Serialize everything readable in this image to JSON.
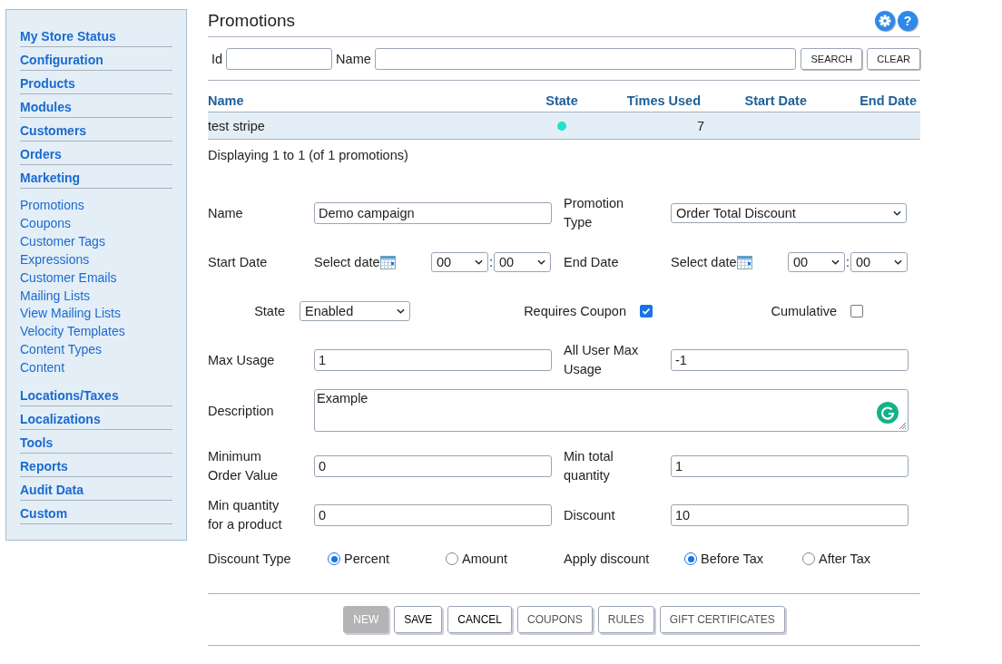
{
  "sidebar": {
    "items": [
      {
        "label": "My Store Status"
      },
      {
        "label": "Configuration"
      },
      {
        "label": "Products"
      },
      {
        "label": "Modules"
      },
      {
        "label": "Customers"
      },
      {
        "label": "Orders"
      },
      {
        "label": "Marketing",
        "children": [
          {
            "label": "Promotions"
          },
          {
            "label": "Coupons"
          },
          {
            "label": "Customer Tags"
          },
          {
            "label": "Expressions"
          },
          {
            "label": "Customer Emails"
          },
          {
            "label": "Mailing Lists"
          },
          {
            "label": "View Mailing Lists"
          },
          {
            "label": "Velocity Templates"
          },
          {
            "label": "Content Types"
          },
          {
            "label": "Content"
          }
        ]
      },
      {
        "label": "Locations/Taxes"
      },
      {
        "label": "Localizations"
      },
      {
        "label": "Tools"
      },
      {
        "label": "Reports"
      },
      {
        "label": "Audit Data"
      },
      {
        "label": "Custom"
      }
    ]
  },
  "page": {
    "title": "Promotions",
    "help_label": "?"
  },
  "search": {
    "id_label": "Id",
    "name_label": "Name",
    "buttons": [
      "SEARCH",
      "CLEAR"
    ]
  },
  "table": {
    "columns": [
      "Name",
      "State",
      "Times Used",
      "Start Date",
      "End Date"
    ],
    "rows": [
      {
        "name": "test stripe",
        "color": "#1de3cf",
        "times_used": "7"
      }
    ]
  },
  "summary": "Displaying 1 to 1 (of 1 promotions)",
  "form": {
    "rows": [
      {
        "kind": "pair",
        "items": [
          {
            "kind": "text",
            "label": "Name",
            "value": "Demo campaign"
          },
          {
            "kind": "select",
            "label": "Promotion Type",
            "value": "Order Total Discount"
          }
        ]
      },
      {
        "kind": "pair",
        "items": [
          {
            "kind": "date",
            "label": "Start Date",
            "placeholder": "Select date",
            "hour": "00",
            "separator": ":",
            "minute": "00"
          },
          {
            "kind": "date",
            "label": "End Date",
            "placeholder": "Select date",
            "hour": "00",
            "separator": ":",
            "minute": "00"
          }
        ]
      },
      {
        "kind": "flags",
        "state": {
          "label": "State",
          "value": "Enabled"
        },
        "checks": [
          {
            "label": "Requires Coupon",
            "checked": true
          },
          {
            "label": "Cumulative",
            "checked": false
          }
        ]
      },
      {
        "kind": "pair",
        "items": [
          {
            "kind": "text",
            "label": "Max Usage",
            "value": "1"
          },
          {
            "kind": "text",
            "label": "All User Max Usage",
            "value": "-1"
          }
        ]
      },
      {
        "kind": "textarea",
        "label": "Description",
        "value": "Example"
      },
      {
        "kind": "pair",
        "items": [
          {
            "kind": "text",
            "label": "Minimum Order Value",
            "value": "0"
          },
          {
            "kind": "text",
            "label": "Min total quantity",
            "value": "1"
          }
        ]
      },
      {
        "kind": "pair",
        "items": [
          {
            "kind": "text",
            "label": "Min quantity for a product",
            "value": "0"
          },
          {
            "kind": "text",
            "label": "Discount",
            "value": "10"
          }
        ]
      },
      {
        "kind": "radios",
        "groups": [
          {
            "label": "Discount Type",
            "options": [
              {
                "label": "Percent",
                "selected": true
              },
              {
                "label": "Amount",
                "selected": false
              }
            ]
          },
          {
            "label": "Apply discount",
            "options": [
              {
                "label": "Before Tax",
                "selected": true
              },
              {
                "label": "After Tax",
                "selected": false
              }
            ]
          }
        ]
      }
    ]
  },
  "actions": [
    {
      "label": "NEW",
      "kind": "disabled"
    },
    {
      "label": "SAVE",
      "kind": "normal"
    },
    {
      "label": "CANCEL",
      "kind": "normal"
    },
    {
      "label": "COUPONS",
      "kind": "muted"
    },
    {
      "label": "RULES",
      "kind": "muted"
    },
    {
      "label": "GIFT CERTIFICATES",
      "kind": "muted"
    }
  ]
}
